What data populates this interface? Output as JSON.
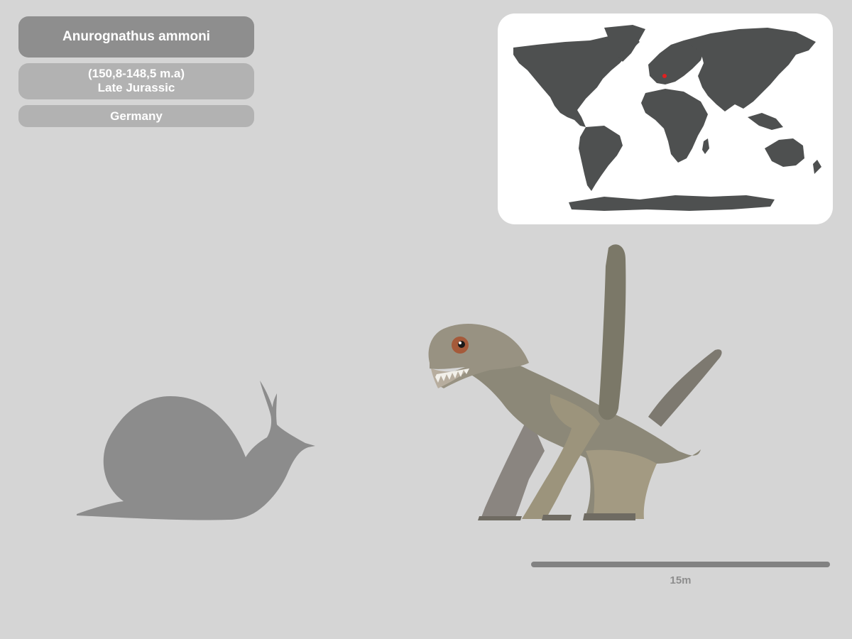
{
  "species": {
    "name": "Anurognathus ammoni",
    "period_range": "(150,8-148,5 m.a)",
    "epoch": "Late Jurassic",
    "location": "Germany"
  },
  "map": {
    "land_color": "#4e5050",
    "marker_color": "#e02020",
    "background_color": "#ffffff"
  },
  "scale": {
    "label": "15m"
  },
  "figures": {
    "comparison_icon": "snail-silhouette",
    "subject": "pterosaur-illustration"
  },
  "colors": {
    "background": "#d5d5d5",
    "title_pill": "#8e8e8e",
    "info_pill": "#b2b2b2",
    "silhouette": "#8c8c8c",
    "scale_bar": "#828282"
  }
}
